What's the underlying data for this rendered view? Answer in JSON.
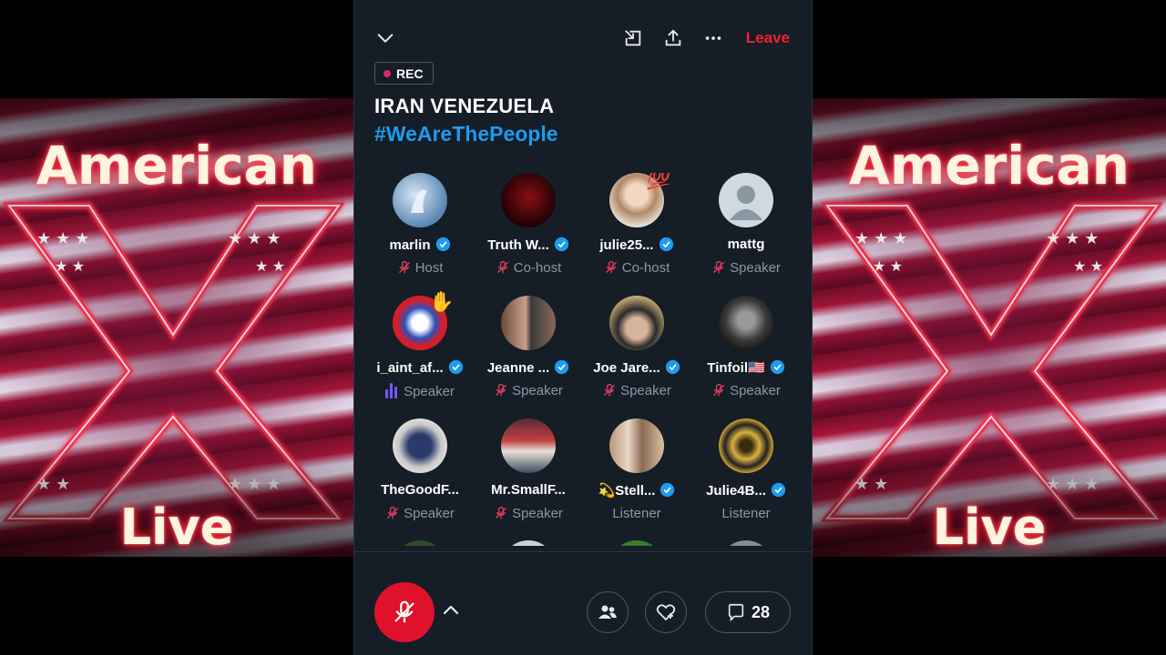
{
  "banners": {
    "top_word": "American",
    "bottom_word": "Live"
  },
  "topbar": {
    "leave_label": "Leave"
  },
  "rec_label": "REC",
  "space": {
    "title": "IRAN  VENEZUELA",
    "hashtag": "#WeAreThePeople"
  },
  "participants": [
    {
      "name": "marlin",
      "verified": true,
      "role": "Host",
      "mic": "muted",
      "avatar": "dolphin-avatar"
    },
    {
      "name": "Truth W...",
      "verified": true,
      "role": "Co-host",
      "mic": "muted",
      "avatar": "dark-red-avatar"
    },
    {
      "name": "julie25...",
      "verified": true,
      "role": "Co-host",
      "mic": "muted",
      "avatar": "woman-photo-avatar",
      "badge": "💯"
    },
    {
      "name": "mattg",
      "verified": false,
      "role": "Speaker",
      "mic": "muted",
      "avatar": "default-avatar"
    },
    {
      "name": "i_aint_af...",
      "verified": true,
      "role": "Speaker",
      "mic": "speaking",
      "avatar": "cartoon-avatar",
      "badge": "✋"
    },
    {
      "name": "Jeanne ...",
      "verified": true,
      "role": "Speaker",
      "mic": "muted",
      "avatar": "couple-photo-avatar"
    },
    {
      "name": "Joe Jare...",
      "verified": true,
      "role": "Speaker",
      "mic": "muted",
      "avatar": "man-hat-avatar"
    },
    {
      "name": "Tinfoil🇺🇸",
      "verified": true,
      "role": "Speaker",
      "mic": "muted",
      "avatar": "man-bw-avatar"
    },
    {
      "name": "TheGoodF...",
      "verified": false,
      "role": "Speaker",
      "mic": "muted",
      "avatar": "globe-avatar"
    },
    {
      "name": "Mr.SmallF...",
      "verified": false,
      "role": "Speaker",
      "mic": "muted",
      "avatar": "room-photo-avatar"
    },
    {
      "name": "💫Stell...",
      "verified": true,
      "role": "Listener",
      "mic": "none",
      "avatar": "group-photo-avatar"
    },
    {
      "name": "Julie4B...",
      "verified": true,
      "role": "Listener",
      "mic": "none",
      "avatar": "sheriff-badge-avatar"
    }
  ],
  "bottombar": {
    "comment_count": "28"
  },
  "colors": {
    "accent_red": "#f4212e",
    "link_blue": "#1d9bf0",
    "panel_bg": "#151d26",
    "verified_blue": "#1d9bf0",
    "speaking_purple": "#7856ff"
  }
}
